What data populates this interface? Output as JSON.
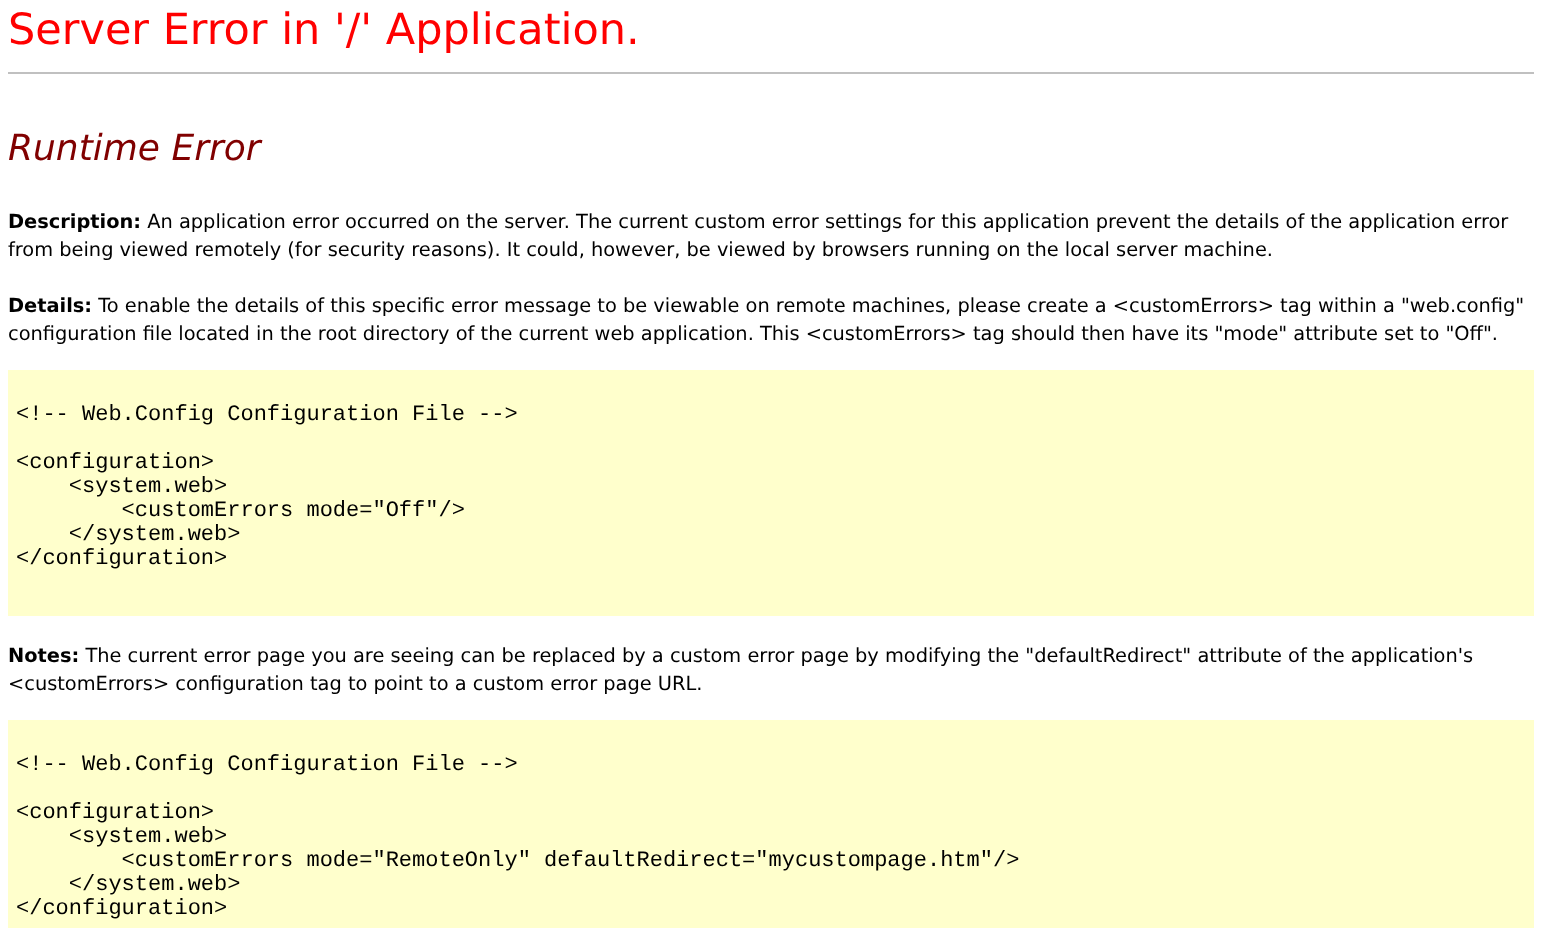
{
  "title": "Server Error in '/' Application.",
  "error_type": "Runtime Error",
  "sections": [
    {
      "kind": "text",
      "text": "**Description:** An application error occurred on the server. The current custom error settings for this application prevent the details of the application error from being viewed remotely (for security reasons). It could, however, be viewed by browsers running on the local server machine."
    },
    {
      "kind": "text",
      "text": "**Details:** To enable the details of this specific error message to be viewable on remote machines, please create a <customErrors> tag within a \"web.config\" configuration file located in the root directory of the current web application. This <customErrors> tag should then have its \"mode\" attribute set to \"Off\"."
    },
    {
      "kind": "code",
      "comment": "<!-- Web.Config Configuration File -->",
      "lines": [
        "<configuration>",
        "    <system.web>",
        "        <customErrors mode=\"Off\"/>",
        "    </system.web>",
        "</configuration>"
      ]
    },
    {
      "kind": "text",
      "text": "**Notes:** The current error page you are seeing can be replaced by a custom error page by modifying the \"defaultRedirect\" attribute of the application's <customErrors> configuration tag to point to a custom error page URL."
    },
    {
      "kind": "code",
      "comment": "<!-- Web.Config Configuration File -->",
      "lines": [
        "<configuration>",
        "    <system.web>",
        "        <customErrors mode=\"RemoteOnly\" defaultRedirect=\"mycustompage.htm\"/>",
        "    </system.web>",
        "</configuration>"
      ]
    }
  ]
}
